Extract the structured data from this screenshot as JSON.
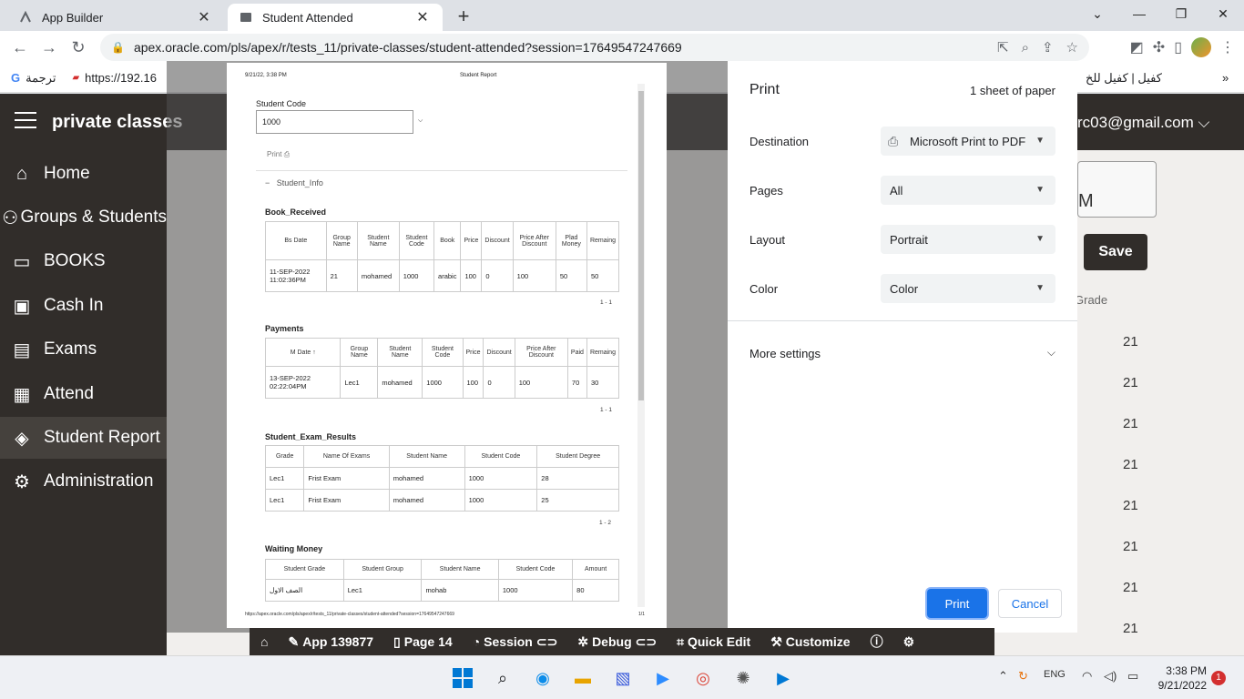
{
  "browser": {
    "tabs": [
      {
        "label": "App Builder"
      },
      {
        "label": "Student Attended"
      }
    ],
    "url": "apex.oracle.com/pls/apex/r/tests_11/private-classes/student-attended?session=17649547247669",
    "bookmarks": [
      {
        "label": "ترجمة"
      },
      {
        "label": "https://192.16"
      },
      {
        "label": "كفيل | كفيل للخ"
      }
    ]
  },
  "app": {
    "title": "private classes",
    "user": "rc03@gmail.com",
    "nav": [
      {
        "label": "Home",
        "icon": "home-icon"
      },
      {
        "label": "Groups & Students",
        "icon": "people-icon"
      },
      {
        "label": "BOOKS",
        "icon": "book-icon"
      },
      {
        "label": "Cash In",
        "icon": "cash-icon"
      },
      {
        "label": "Exams",
        "icon": "document-icon"
      },
      {
        "label": "Attend",
        "icon": "clipboard-icon"
      },
      {
        "label": "Student Report",
        "icon": "graduation-cap-icon",
        "active": true
      },
      {
        "label": "Administration",
        "icon": "user-settings-icon"
      }
    ],
    "bg": {
      "panel_text": "M",
      "save_label": "Save",
      "grade_header": "Grade",
      "grades": [
        "21",
        "21",
        "21",
        "21",
        "21",
        "21",
        "21",
        "21"
      ]
    },
    "devbar": {
      "app": "App 139877",
      "page": "Page 14",
      "session": "Session",
      "debug": "Debug",
      "quick_edit": "Quick Edit",
      "customize": "Customize"
    }
  },
  "preview": {
    "header_date": "9/21/22, 3:38 PM",
    "header_title": "Student Report",
    "student_code_label": "Student Code",
    "student_code_value": "1000",
    "print_label": "Print",
    "region_title": "Student_Info",
    "book_received": {
      "title": "Book_Received",
      "columns": [
        "Bs Date",
        "Group Name",
        "Student Name",
        "Student Code",
        "Book",
        "Price",
        "Discount",
        "Price After Discount",
        "Plad Money",
        "Remaing"
      ],
      "rows": [
        [
          "11-SEP-2022 11:02:36PM",
          "21",
          "mohamed",
          "1000",
          "arabic",
          "100",
          "0",
          "100",
          "50",
          "50"
        ]
      ],
      "pagination": "1 - 1"
    },
    "payments": {
      "title": "Payments",
      "columns": [
        "M Date",
        "Group Name",
        "Student Name",
        "Student Code",
        "Price",
        "Discount",
        "Price After Discount",
        "Paid",
        "Remaing"
      ],
      "rows": [
        [
          "13-SEP-2022 02:22:04PM",
          "Lec1",
          "mohamed",
          "1000",
          "100",
          "0",
          "100",
          "70",
          "30"
        ]
      ],
      "pagination": "1 - 1"
    },
    "exam_results": {
      "title": "Student_Exam_Results",
      "columns": [
        "Grade",
        "Name Of Exams",
        "Student Name",
        "Student Code",
        "Student Degree"
      ],
      "rows": [
        [
          "Lec1",
          "Frist Exam",
          "mohamed",
          "1000",
          "28"
        ],
        [
          "Lec1",
          "Frist Exam",
          "mohamed",
          "1000",
          "25"
        ]
      ],
      "pagination": "1 - 2"
    },
    "waiting_money": {
      "title": "Waiting Money",
      "columns": [
        "Student Grade",
        "Student Group",
        "Student Name",
        "Student Code",
        "Amount"
      ],
      "rows": [
        [
          "الصف الاول",
          "Lec1",
          "mohab",
          "1000",
          "80"
        ]
      ]
    },
    "footer_url": "https://apex.oracle.com/pls/apex/r/tests_11/private-classes/student-attended?session=17649547247669",
    "footer_page": "1/1"
  },
  "print_dialog": {
    "title": "Print",
    "sheets": "1 sheet of paper",
    "destination_label": "Destination",
    "destination_value": "Microsoft Print to PDF",
    "pages_label": "Pages",
    "pages_value": "All",
    "layout_label": "Layout",
    "layout_value": "Portrait",
    "color_label": "Color",
    "color_value": "Color",
    "more_settings": "More settings",
    "print_button": "Print",
    "cancel_button": "Cancel"
  },
  "taskbar": {
    "lang": "ENG",
    "time": "3:38 PM",
    "date": "9/21/2022",
    "notifications": "1"
  },
  "colors": {
    "header_bg": "#312d2a",
    "print_blue": "#1a73e8"
  }
}
